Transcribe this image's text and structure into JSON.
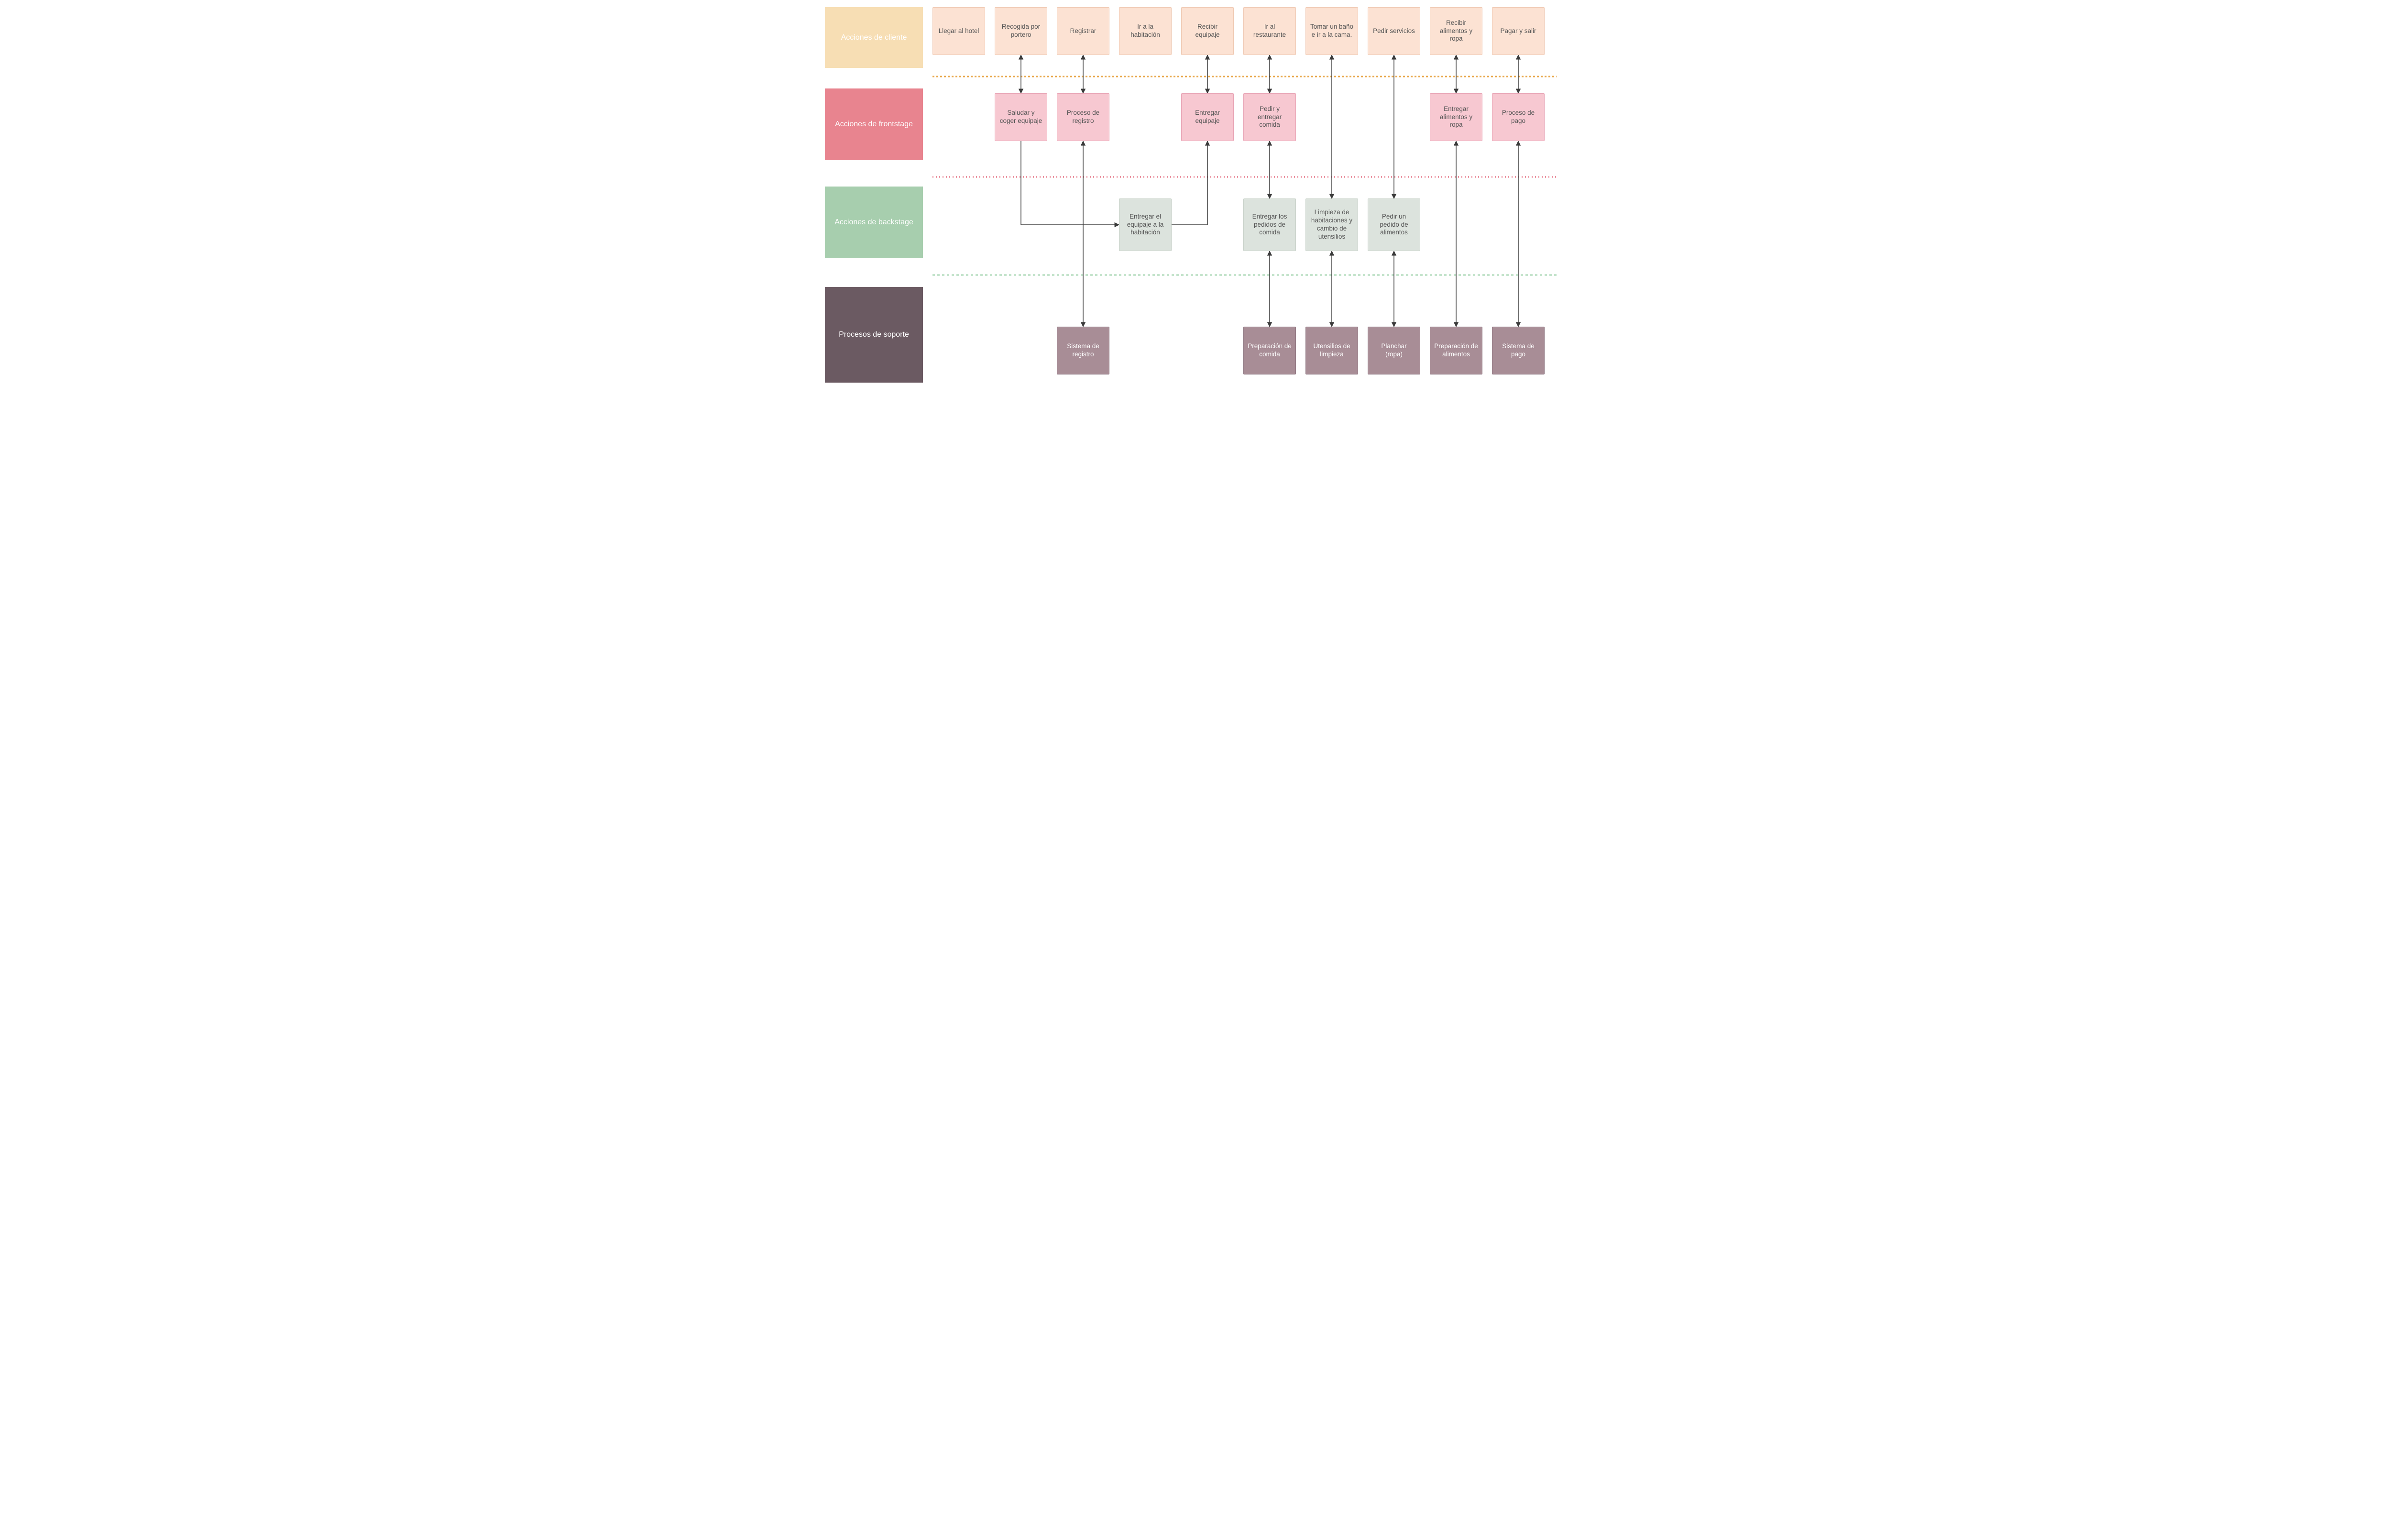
{
  "diagram_type": "service-blueprint",
  "lanes": {
    "customer": "Acciones de cliente",
    "frontstage": "Acciones de frontstage",
    "backstage": "Acciones de backstage",
    "support": "Procesos de soporte"
  },
  "customer_actions": [
    "Llegar al hotel",
    "Recogida por portero",
    "Registrar",
    "Ir a la habitación",
    "Recibir equipaje",
    "Ir al restaurante",
    "Tomar un baño e ir a la cama.",
    "Pedir servicios",
    "Recibir alimentos y ropa",
    "Pagar y salir"
  ],
  "frontstage_actions": {
    "1": "Saludar y coger equipaje",
    "2": "Proceso de registro",
    "4": "Entregar equipaje",
    "5": "Pedir y entregar comida",
    "8": "Entregar alimentos y ropa",
    "9": "Proceso de pago"
  },
  "backstage_actions": {
    "3": "Entregar el equipaje a la habitación",
    "5": "Entregar los pedidos de comida",
    "6": "Limpieza de habitaciones y cambio de utensilios",
    "7": "Pedir un pedido de alimentos"
  },
  "support_processes": {
    "2": "Sistema de registro",
    "5": "Preparación de comida",
    "6": "Utensilios de limpieza",
    "7": "Planchar (ropa)",
    "8": "Preparación de alimentos",
    "9": "Sistema de pago"
  },
  "colors": {
    "lane_customer": "#f7deb4",
    "lane_front": "#e8848f",
    "lane_back": "#a7ceae",
    "lane_support": "#6b5a62",
    "box_customer": "#fce2d3",
    "box_front": "#f7c8d1",
    "box_back": "#dce3dd",
    "box_support": "#a88d96",
    "divider_interaction": "#e8a94f",
    "divider_visibility": "#e36b7e",
    "divider_internal": "#97cfa6",
    "arrow": "#3a3a3a"
  }
}
